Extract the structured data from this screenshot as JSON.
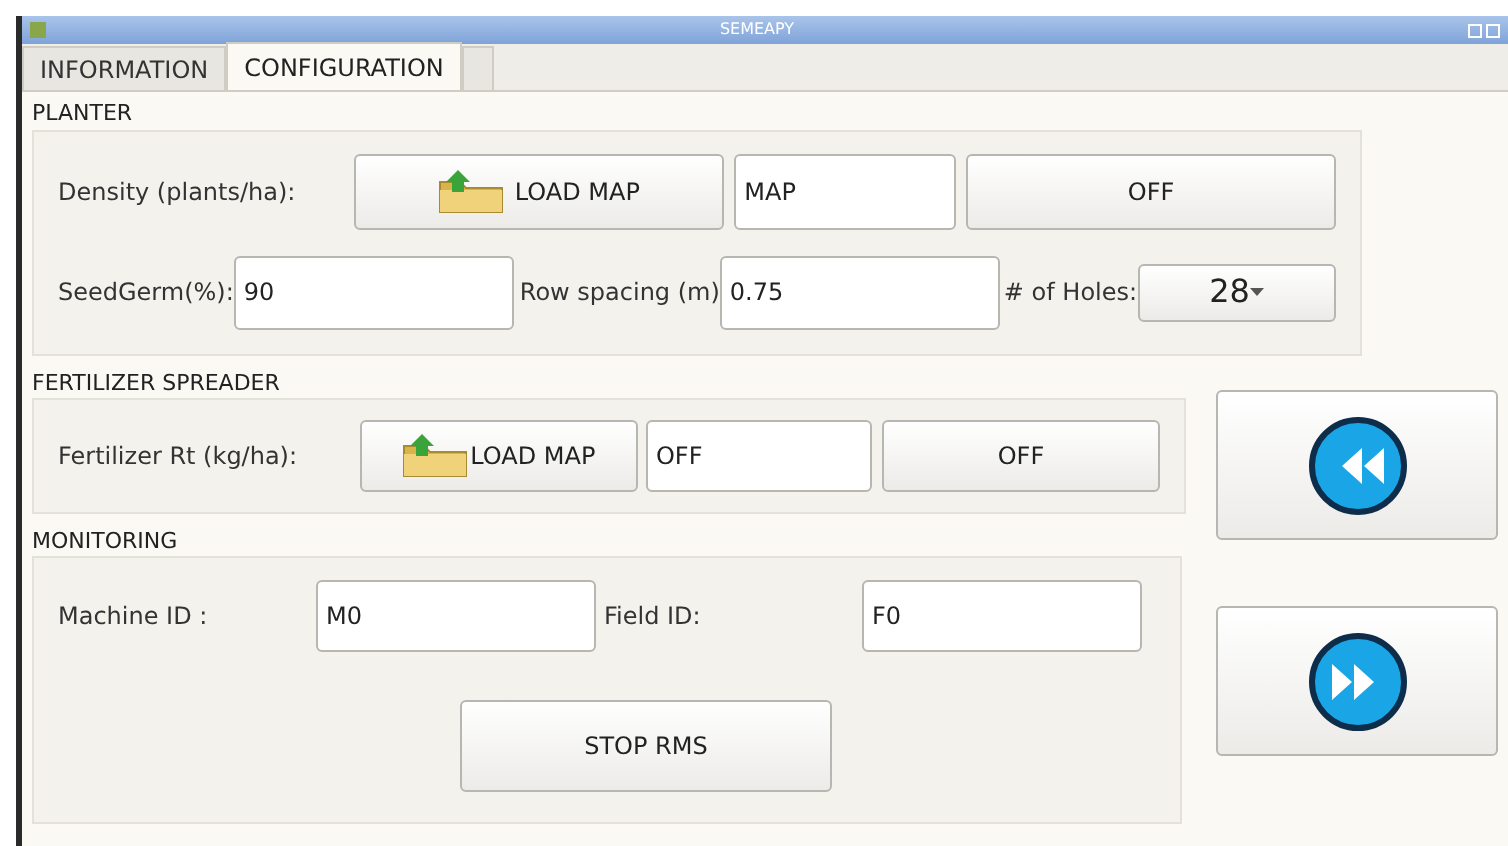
{
  "window": {
    "title": "SEMEAPY"
  },
  "tabs": [
    {
      "label": "INFORMATION",
      "selected": false
    },
    {
      "label": "CONFIGURATION",
      "selected": true
    }
  ],
  "planter": {
    "title": "PLANTER",
    "density_label": "Density (plants/ha):",
    "load_button": "LOAD MAP",
    "density_value": "MAP",
    "toggle_button": "OFF",
    "seedgerm_label": "SeedGerm(%):",
    "seedgerm_value": "90",
    "row_spacing_label": "Row spacing (m)",
    "row_spacing_value": "0.75",
    "holes_label": "# of Holes:",
    "holes_value": "28"
  },
  "fertilizer": {
    "title": "FERTILIZER SPREADER",
    "rate_label": "Fertilizer Rt (kg/ha):",
    "load_button": "LOAD MAP",
    "rate_value": "OFF",
    "toggle_button": "OFF"
  },
  "monitoring": {
    "title": "MONITORING",
    "machine_label": "Machine ID :",
    "machine_value": "M0",
    "field_label": "Field ID:",
    "field_value": "F0",
    "stop_button": "STOP RMS"
  }
}
